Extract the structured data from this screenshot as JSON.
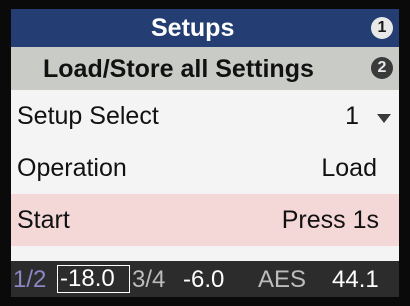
{
  "header": {
    "title": "Setups",
    "badge": "1"
  },
  "subheader": {
    "title": "Load/Store all Settings",
    "badge": "2"
  },
  "settings": [
    {
      "label": "Setup Select",
      "value": "1",
      "control": "dropdown"
    },
    {
      "label": "Operation",
      "value": "Load"
    },
    {
      "label": "Start",
      "value": "Press 1s"
    }
  ],
  "status_bar": {
    "channel_a": "1/2",
    "level_a": "-18.0",
    "channel_b": "3/4",
    "level_b": "-6.0",
    "input": "AES",
    "sample_rate": "44.1"
  },
  "colors": {
    "header_bg": "#243e73",
    "subheader_bg": "#c9cbc7",
    "highlight_row_bg": "#f3d8d7",
    "status_bg": "#2c2c2c",
    "channel_a_color": "#8a87c6"
  },
  "icons": {
    "setup_select": "chevron-down-icon"
  }
}
